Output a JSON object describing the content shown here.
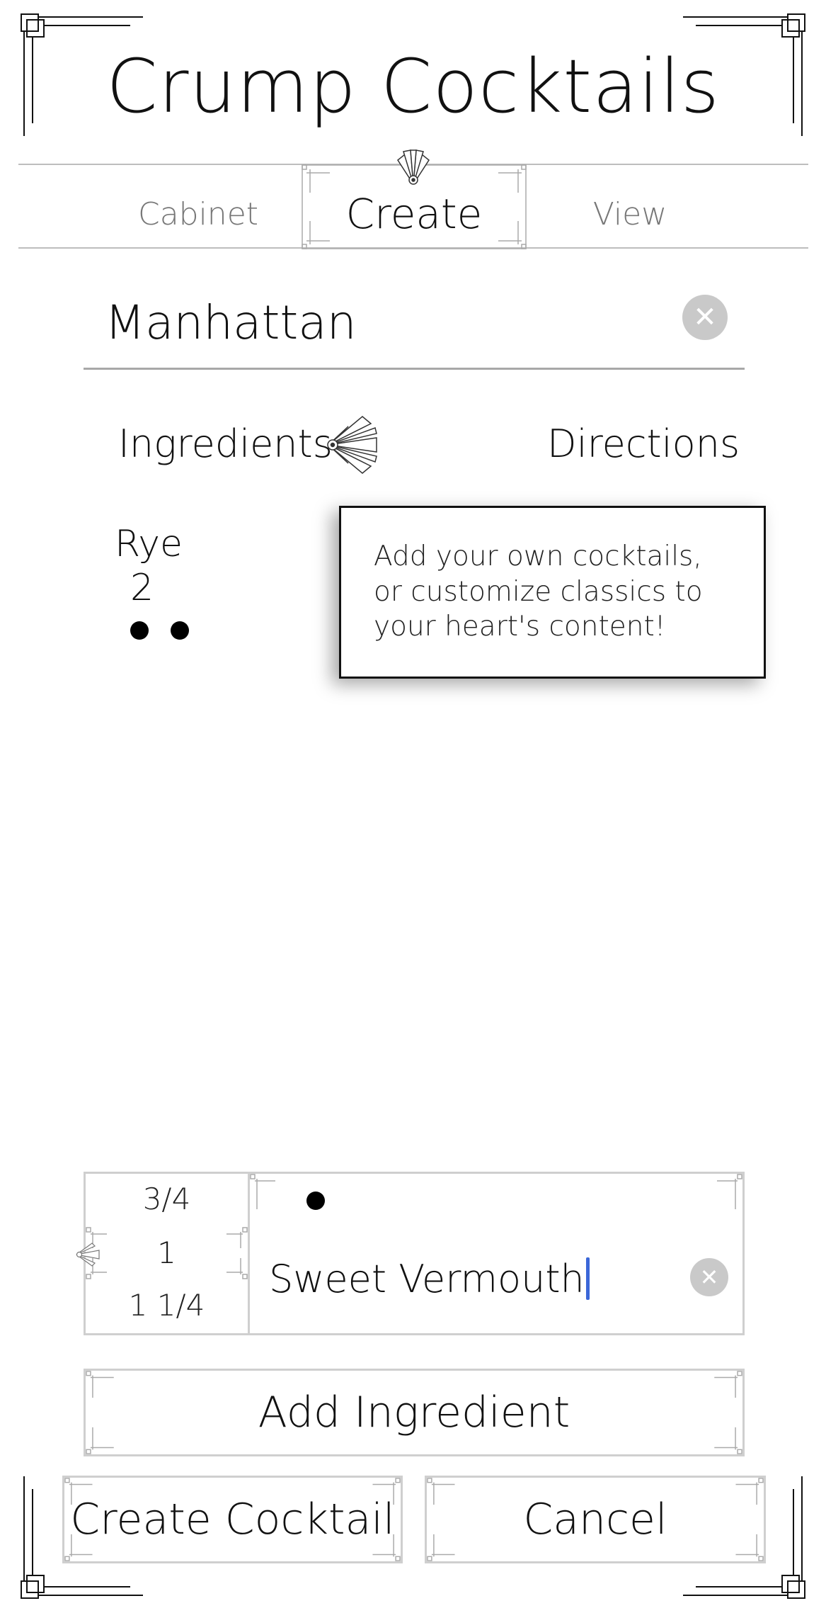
{
  "app": {
    "title": "Crump Cocktails"
  },
  "nav": {
    "tabs": [
      {
        "label": "Cabinet",
        "active": false
      },
      {
        "label": "Create",
        "active": true
      },
      {
        "label": "View",
        "active": false
      }
    ]
  },
  "cocktail": {
    "name": "Manhattan"
  },
  "subtabs": {
    "ingredients": "Ingredients",
    "directions": "Directions"
  },
  "ingredients": [
    {
      "name": "Rye",
      "amount": "2",
      "dots": 2
    }
  ],
  "tooltip": {
    "text": "Add your own cocktails, or customize classics to your heart's content!"
  },
  "picker": {
    "amounts": [
      "3/4",
      "1",
      "1 1/4"
    ],
    "selected_amount": "1",
    "unit_dots": 1,
    "ingredient_value": "Sweet Vermouth"
  },
  "buttons": {
    "add_ingredient": "Add Ingredient",
    "create_cocktail": "Create Cocktail",
    "cancel": "Cancel"
  },
  "icons": {
    "clear": "clear-icon",
    "fan": "art-deco-fan-icon"
  },
  "colors": {
    "accent_caret": "#3b67d8",
    "divider": "#bdbdbd",
    "clear_button": "#c9c9c9"
  }
}
